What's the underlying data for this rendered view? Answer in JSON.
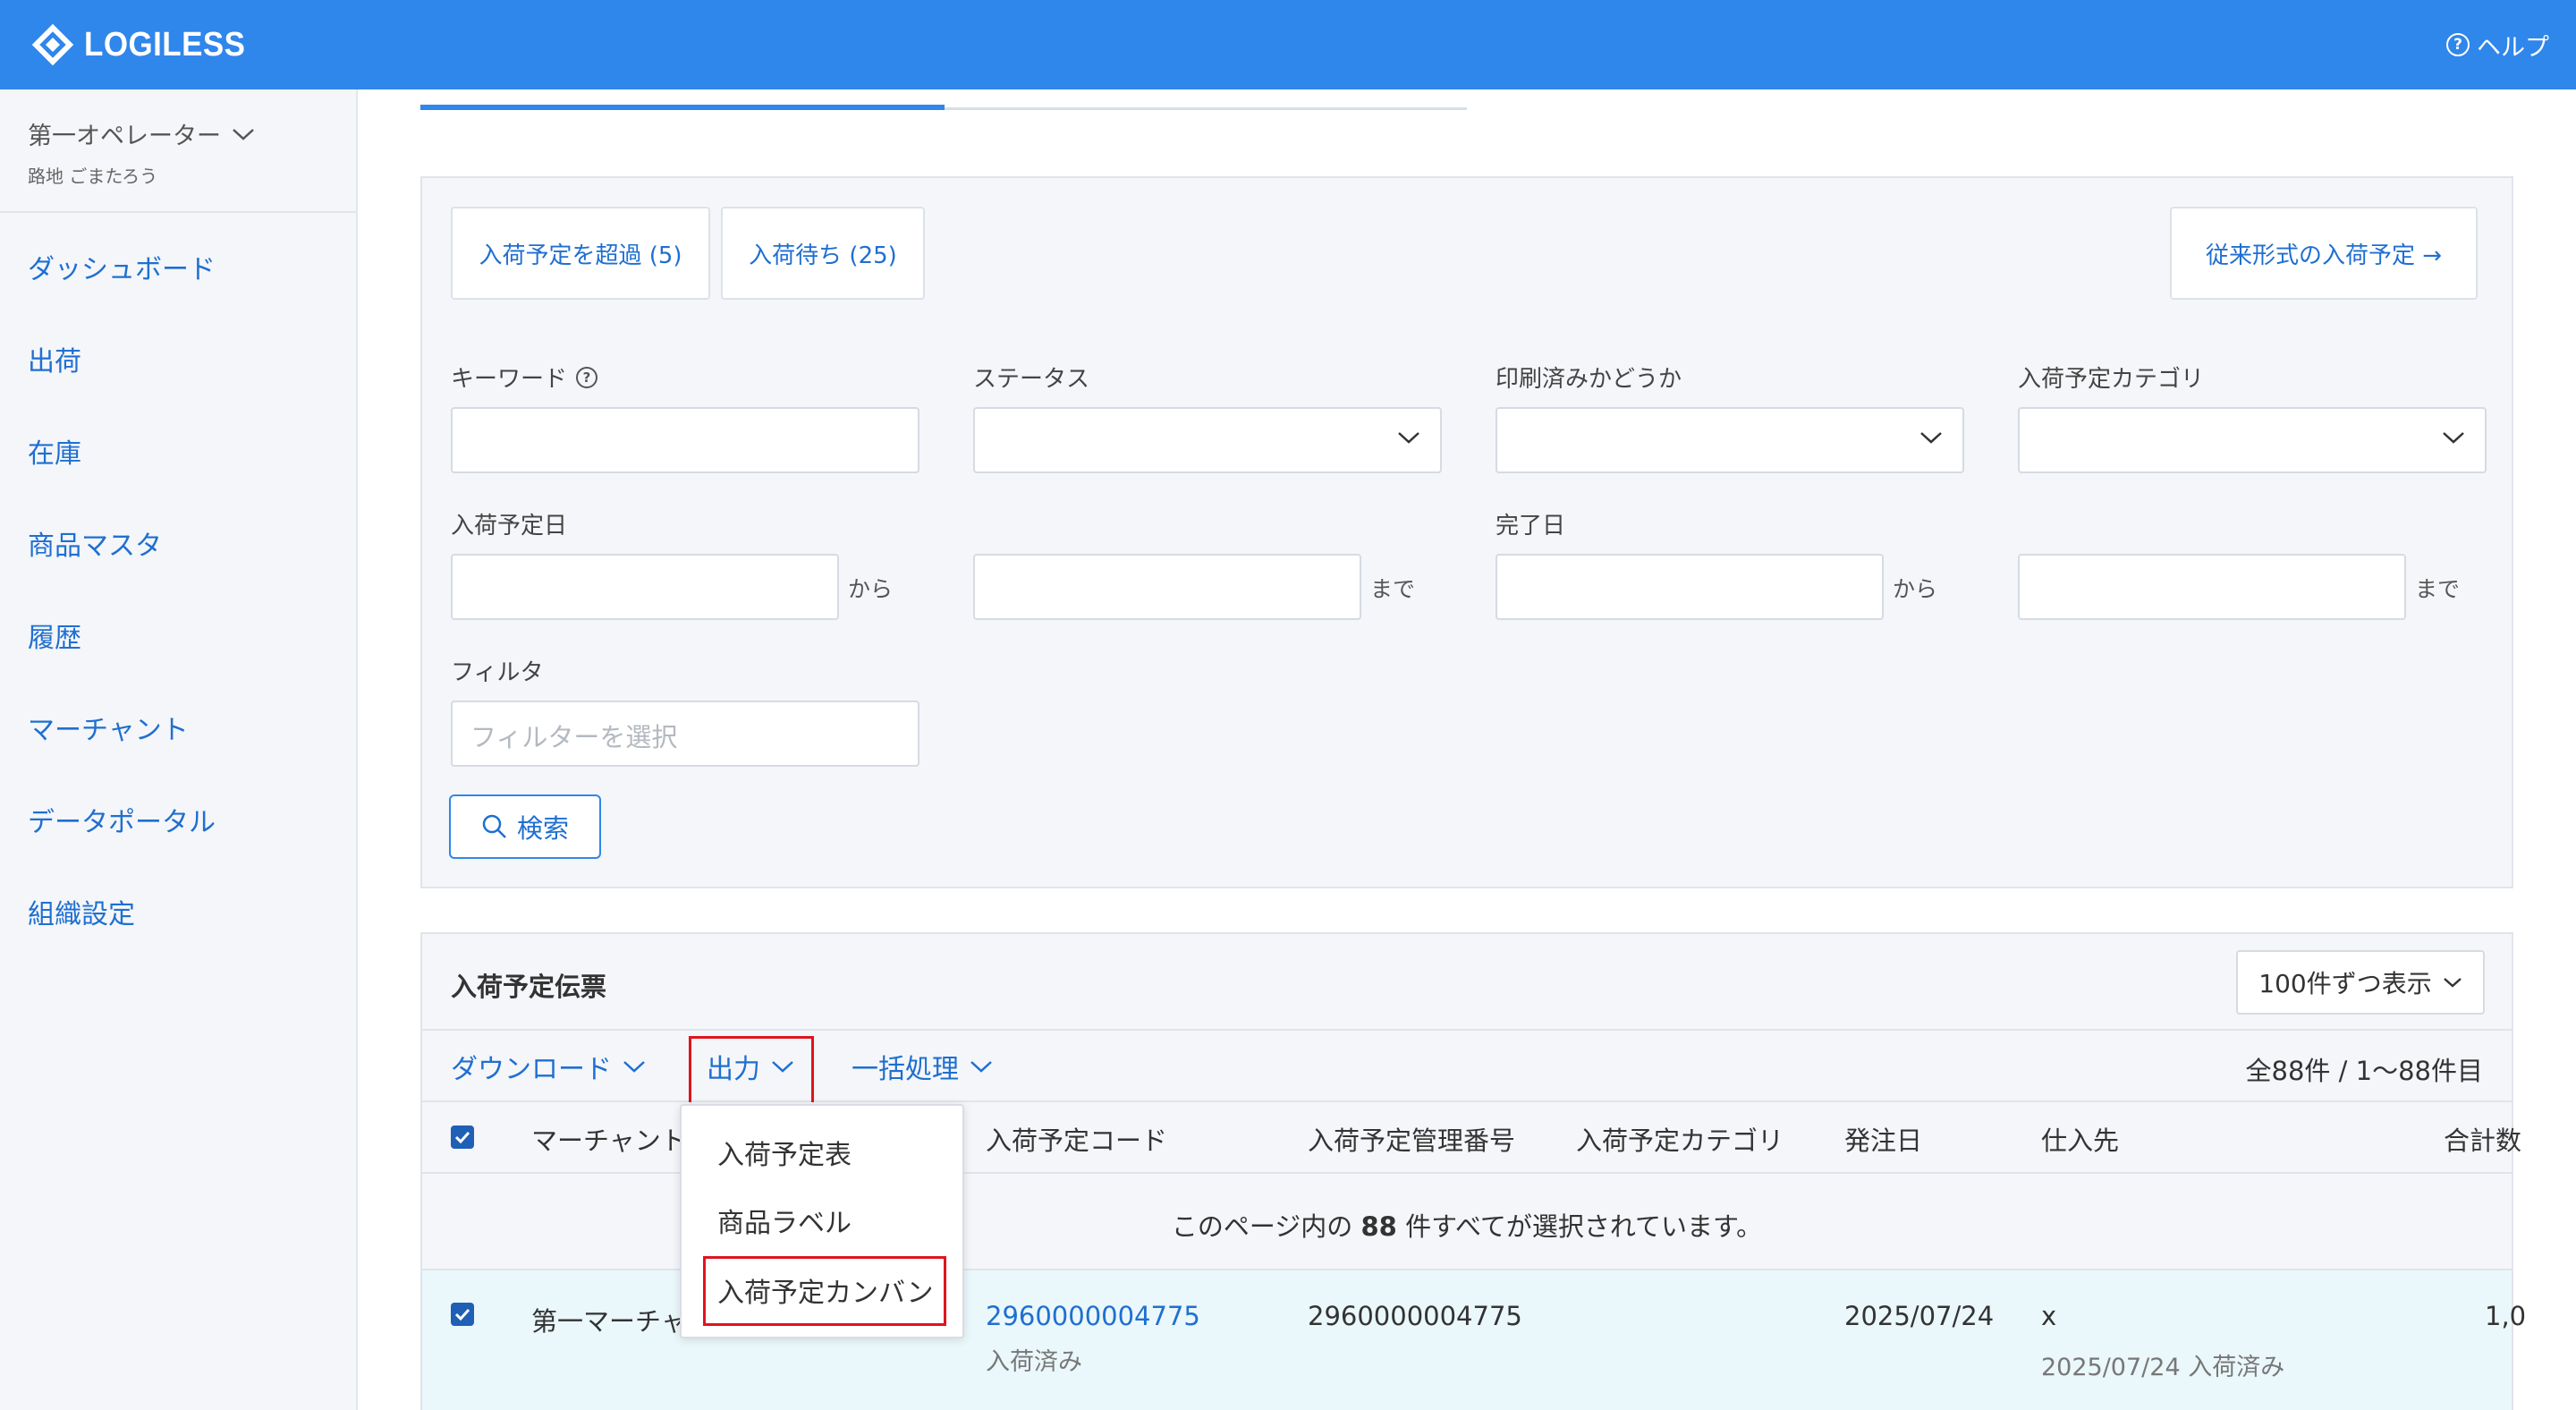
{
  "header": {
    "logo_text": "LOGILESS",
    "help_label": "ヘルプ"
  },
  "sidebar": {
    "user_name": "第一オペレーター",
    "user_sub": "路地 ごまたろう",
    "items": [
      {
        "label": "ダッシュボード"
      },
      {
        "label": "出荷"
      },
      {
        "label": "在庫"
      },
      {
        "label": "商品マスタ"
      },
      {
        "label": "履歴"
      },
      {
        "label": "マーチャント"
      },
      {
        "label": "データポータル"
      },
      {
        "label": "組織設定"
      }
    ]
  },
  "filters": {
    "quick_buttons": [
      "入荷予定を超過 (5)",
      "入荷待ち (25)"
    ],
    "legacy_link": "従来形式の入荷予定 →",
    "keyword_label": "キーワード",
    "status_label": "ステータス",
    "printed_label": "印刷済みかどうか",
    "category_label": "入荷予定カテゴリ",
    "date_label": "入荷予定日",
    "done_label": "完了日",
    "from": "から",
    "to": "まで",
    "filter_label": "フィルタ",
    "filter_placeholder": "フィルターを選択",
    "search_label": "検索"
  },
  "results": {
    "title": "入荷予定伝票",
    "per_page": "100件ずつ表示",
    "tools": [
      "ダウンロード",
      "出力",
      "一括処理"
    ],
    "count": "全88件 / 1〜88件目",
    "columns": [
      "マーチャント",
      "入荷予定コード",
      "入荷予定管理番号",
      "入荷予定カテゴリ",
      "発注日",
      "仕入先",
      "合計数"
    ],
    "select_msg_pre": "このページ内の",
    "select_msg_num": "88",
    "select_msg_post": "件すべてが選択されています。",
    "row": {
      "merchant": "第一マーチャ",
      "code": "2960000004775",
      "status": "入荷済み",
      "mgmt_no": "2960000004775",
      "order_date": "2025/07/24",
      "supplier": "x",
      "supplier_sub": "2025/07/24 入荷済み",
      "total": "1,0"
    }
  },
  "dropdown": {
    "items": [
      "入荷予定表",
      "商品ラベル",
      "入荷予定カンバン"
    ]
  },
  "colors": {
    "brand": "#2f86eb",
    "link": "#1f6fd1",
    "highlight": "#e0141e"
  }
}
